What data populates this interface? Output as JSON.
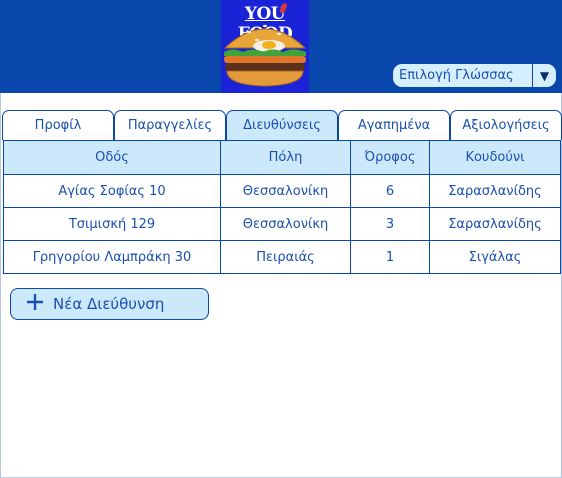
{
  "logo": {
    "text": "YOU FOOD",
    "icon": "burger-icon",
    "background": "#1a23d6"
  },
  "language": {
    "label": "Επιλογή Γλώσσας",
    "arrow_icon": "triangle-down-icon"
  },
  "tabs": [
    {
      "label": "Προφίλ",
      "active": false
    },
    {
      "label": "Παραγγελίες",
      "active": false
    },
    {
      "label": "Διευθύνσεις",
      "active": true
    },
    {
      "label": "Αγαπημένα",
      "active": false
    },
    {
      "label": "Αξιολογήσεις",
      "active": false
    }
  ],
  "table": {
    "headers": [
      "Οδός",
      "Πόλη",
      "Όροφος",
      "Κουδούνι"
    ],
    "rows": [
      [
        "Αγίας Σοφίας 10",
        "Θεσσαλονίκη",
        "6",
        "Σαρασλανίδης"
      ],
      [
        "Τσιμισκή 129",
        "Θεσσαλονίκη",
        "3",
        "Σαρασλανίδης"
      ],
      [
        "Γρηγορίου Λαμπράκη 30",
        "Πειραιάς",
        "1",
        "Σιγάλας"
      ]
    ]
  },
  "new_address": {
    "label": "Νέα Διεύθυνση",
    "icon": "plus-icon"
  },
  "colors": {
    "header": "#0a47ad",
    "accent_light": "#cce9fb",
    "text": "#1a4fb0"
  }
}
